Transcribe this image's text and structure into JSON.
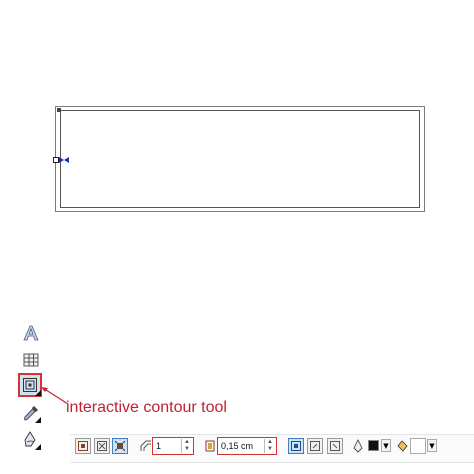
{
  "callout": {
    "label": "interactive contour tool"
  },
  "toolbox": {
    "items": [
      {
        "name": "artistic-text-tool",
        "icon": "text-A-icon"
      },
      {
        "name": "table-tool",
        "icon": "table-icon"
      },
      {
        "name": "interactive-contour-tool",
        "icon": "contour-icon",
        "selected": true
      },
      {
        "name": "eyedropper-tool",
        "icon": "eyedropper-icon"
      },
      {
        "name": "fill-tool",
        "icon": "fill-bucket-icon"
      }
    ]
  },
  "property_bar": {
    "steps_value": "1",
    "offset_value": "0,15 cm",
    "outline_color": "#111111",
    "fill_color": "#ffffff"
  },
  "colors": {
    "highlight_red": "#d23434",
    "callout_text": "#c0232e",
    "selected_bg": "#cfe2f5"
  }
}
